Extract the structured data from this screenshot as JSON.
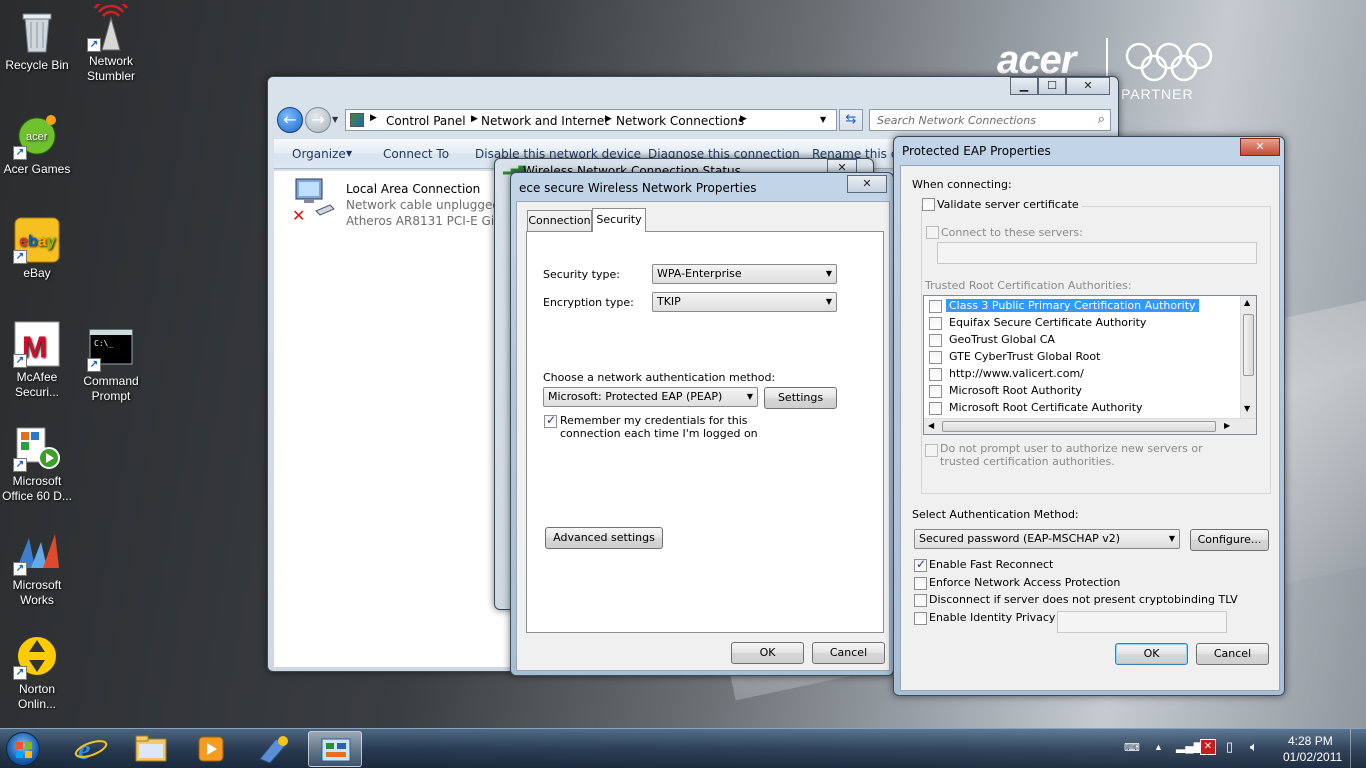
{
  "desktop": {
    "brand": {
      "name": "acer",
      "tagline": "PARTNER"
    },
    "icons": [
      {
        "label": "Recycle Bin",
        "icon": "recycle-bin-icon"
      },
      {
        "label": "Network Stumbler",
        "icon": "network-stumbler-icon"
      },
      {
        "label": "Acer Games",
        "icon": "acer-games-icon"
      },
      {
        "label": "eBay",
        "icon": "ebay-icon"
      },
      {
        "label": "McAfee Securi...",
        "icon": "mcafee-icon"
      },
      {
        "label": "Command Prompt",
        "icon": "command-prompt-icon"
      },
      {
        "label": "Microsoft Office 60 D...",
        "icon": "office-icon"
      },
      {
        "label": "Microsoft Works",
        "icon": "works-icon"
      },
      {
        "label": "Norton Onlin...",
        "icon": "norton-icon"
      }
    ]
  },
  "explorer": {
    "breadcrumb": [
      "Control Panel",
      "Network and Internet",
      "Network Connections"
    ],
    "search_placeholder": "Search Network Connections",
    "toolbar": {
      "organize": "Organize",
      "connect_to": "Connect To",
      "disable": "Disable this network device",
      "diagnose": "Diagnose this connection",
      "rename": "Rename this co"
    },
    "connection": {
      "name": "Local Area Connection",
      "status": "Network cable unplugged",
      "adapter": "Atheros AR8131 PCI-E Gigab"
    }
  },
  "status_window": {
    "title": "Wireless Network Connection Status"
  },
  "props": {
    "title": "ece secure Wireless Network Properties",
    "tabs": [
      "Connection",
      "Security"
    ],
    "security_type_label": "Security type:",
    "security_type": "WPA-Enterprise",
    "encryption_type_label": "Encryption type:",
    "encryption_type": "TKIP",
    "auth_method_label": "Choose a network authentication method:",
    "auth_method": "Microsoft: Protected EAP (PEAP)",
    "settings": "Settings",
    "remember": "Remember my credentials for this connection each time I'm logged on",
    "advanced": "Advanced settings",
    "ok": "OK",
    "cancel": "Cancel"
  },
  "peap": {
    "title": "Protected EAP Properties",
    "when_connecting": "When connecting:",
    "validate_cert": "Validate server certificate",
    "connect_servers": "Connect to these servers:",
    "trusted_roots": "Trusted Root Certification Authorities:",
    "authorities": [
      "Class 3 Public Primary Certification Authority",
      "Equifax Secure Certificate Authority",
      "GeoTrust Global CA",
      "GTE CyberTrust Global Root",
      "http://www.valicert.com/",
      "Microsoft Root Authority",
      "Microsoft Root Certificate Authority"
    ],
    "no_prompt": "Do not prompt user to authorize new servers or trusted certification authorities.",
    "select_auth_label": "Select Authentication Method:",
    "auth_method": "Secured password (EAP-MSCHAP v2)",
    "configure": "Configure...",
    "fast_reconnect": "Enable Fast Reconnect",
    "nap": "Enforce Network Access Protection",
    "cryptobinding": "Disconnect if server does not present cryptobinding TLV",
    "identity_privacy": "Enable Identity Privacy",
    "ok": "OK",
    "cancel": "Cancel"
  },
  "taskbar": {
    "time": "4:28 PM",
    "date": "01/02/2011"
  }
}
